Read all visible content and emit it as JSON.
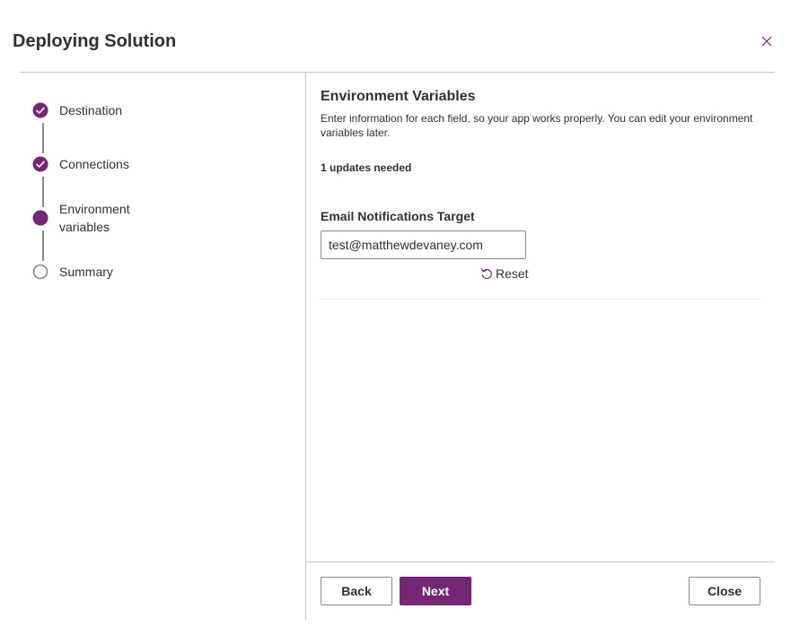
{
  "dialog": {
    "title": "Deploying Solution"
  },
  "colors": {
    "accent": "#742774",
    "text": "#323130",
    "divider": "#c8c6c4",
    "inactive_step": "#8a8886"
  },
  "stepper": {
    "steps": [
      {
        "label": "Destination",
        "state": "completed",
        "icon": "check-circle-icon"
      },
      {
        "label": "Connections",
        "state": "completed",
        "icon": "check-circle-icon"
      },
      {
        "label": "Environment variables",
        "state": "current",
        "icon": "filled-circle-icon"
      },
      {
        "label": "Summary",
        "state": "pending",
        "icon": "empty-circle-icon"
      }
    ]
  },
  "main": {
    "section_title": "Environment Variables",
    "section_description": "Enter information for each field, so your app works properly. You can edit your environment variables later.",
    "updates_needed": "1 updates needed",
    "field": {
      "label": "Email Notifications Target",
      "value": "test@matthewdevaney.com"
    },
    "reset_label": "Reset"
  },
  "footer": {
    "back_label": "Back",
    "next_label": "Next",
    "close_label": "Close"
  }
}
